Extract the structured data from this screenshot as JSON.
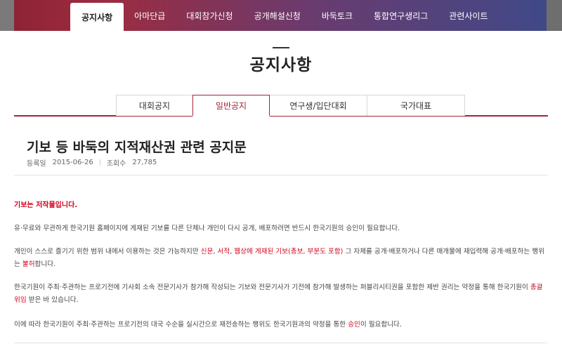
{
  "nav": {
    "items": [
      "공지사항",
      "아마단급",
      "대회참가신청",
      "공개해설신청",
      "바둑토크",
      "통합연구생리그",
      "관련사이트"
    ],
    "active_index": 0
  },
  "page": {
    "title": "공지사항"
  },
  "tabs": {
    "items": [
      "대회공지",
      "일반공지",
      "연구생/입단대회",
      "국가대표"
    ],
    "active_index": 1
  },
  "article": {
    "title": "기보 등 바둑의 지적재산권 관련 공지문",
    "meta": {
      "date_label": "등록일",
      "date": "2015-06-26",
      "views_label": "조회수",
      "views": "27,785"
    },
    "lead": "기보는 저작물입니다.",
    "p1": "유·무료와 무관하게 한국기원 홈페이지에 게재된 기보를 다른 단체나 개인이 다시 공개, 배포하려면 반드시 한국기원의 승인이 필요합니다.",
    "p2": {
      "a": "개인이 스스로 즐기기 위한 범위 내에서 이용하는 것은 가능하지만 ",
      "r1": "신문",
      "c1": ", ",
      "r2": "서적",
      "c2": ", ",
      "r3": "웹상에 게재된 기보(총보, 부분도 포함)",
      "b": " 그 자체를 공개·배포하거나 다른 매개물에 재입력해 공개·배포하는 행위는 ",
      "r4": "불허",
      "c": "합니다."
    },
    "p3": {
      "a": "한국기원이 주최·주관하는 프로기전에 기사회 소속 전문기사가 참가해 작성되는 기보와 전문기사가 기전에 참가해 발생하는 퍼블리시티권을 포함한 제반 권리는 약정을 통해 한국기원이 ",
      "r1": "총괄위임",
      "b": " 받은 바 있습니다."
    },
    "p4": {
      "a": "이에 따라 한국기원이 주최·주관하는 프로기전의 대국 수순을 실시간으로 재전송하는 행위도 한국기원과의 약정을 통한 ",
      "r1": "승인",
      "b": "이 필요합니다."
    }
  },
  "colors": {
    "accent": "#a2243b",
    "highlight": "#d0021b",
    "nav_start": "#9e2b3f",
    "nav_end": "#3d4a8a"
  }
}
